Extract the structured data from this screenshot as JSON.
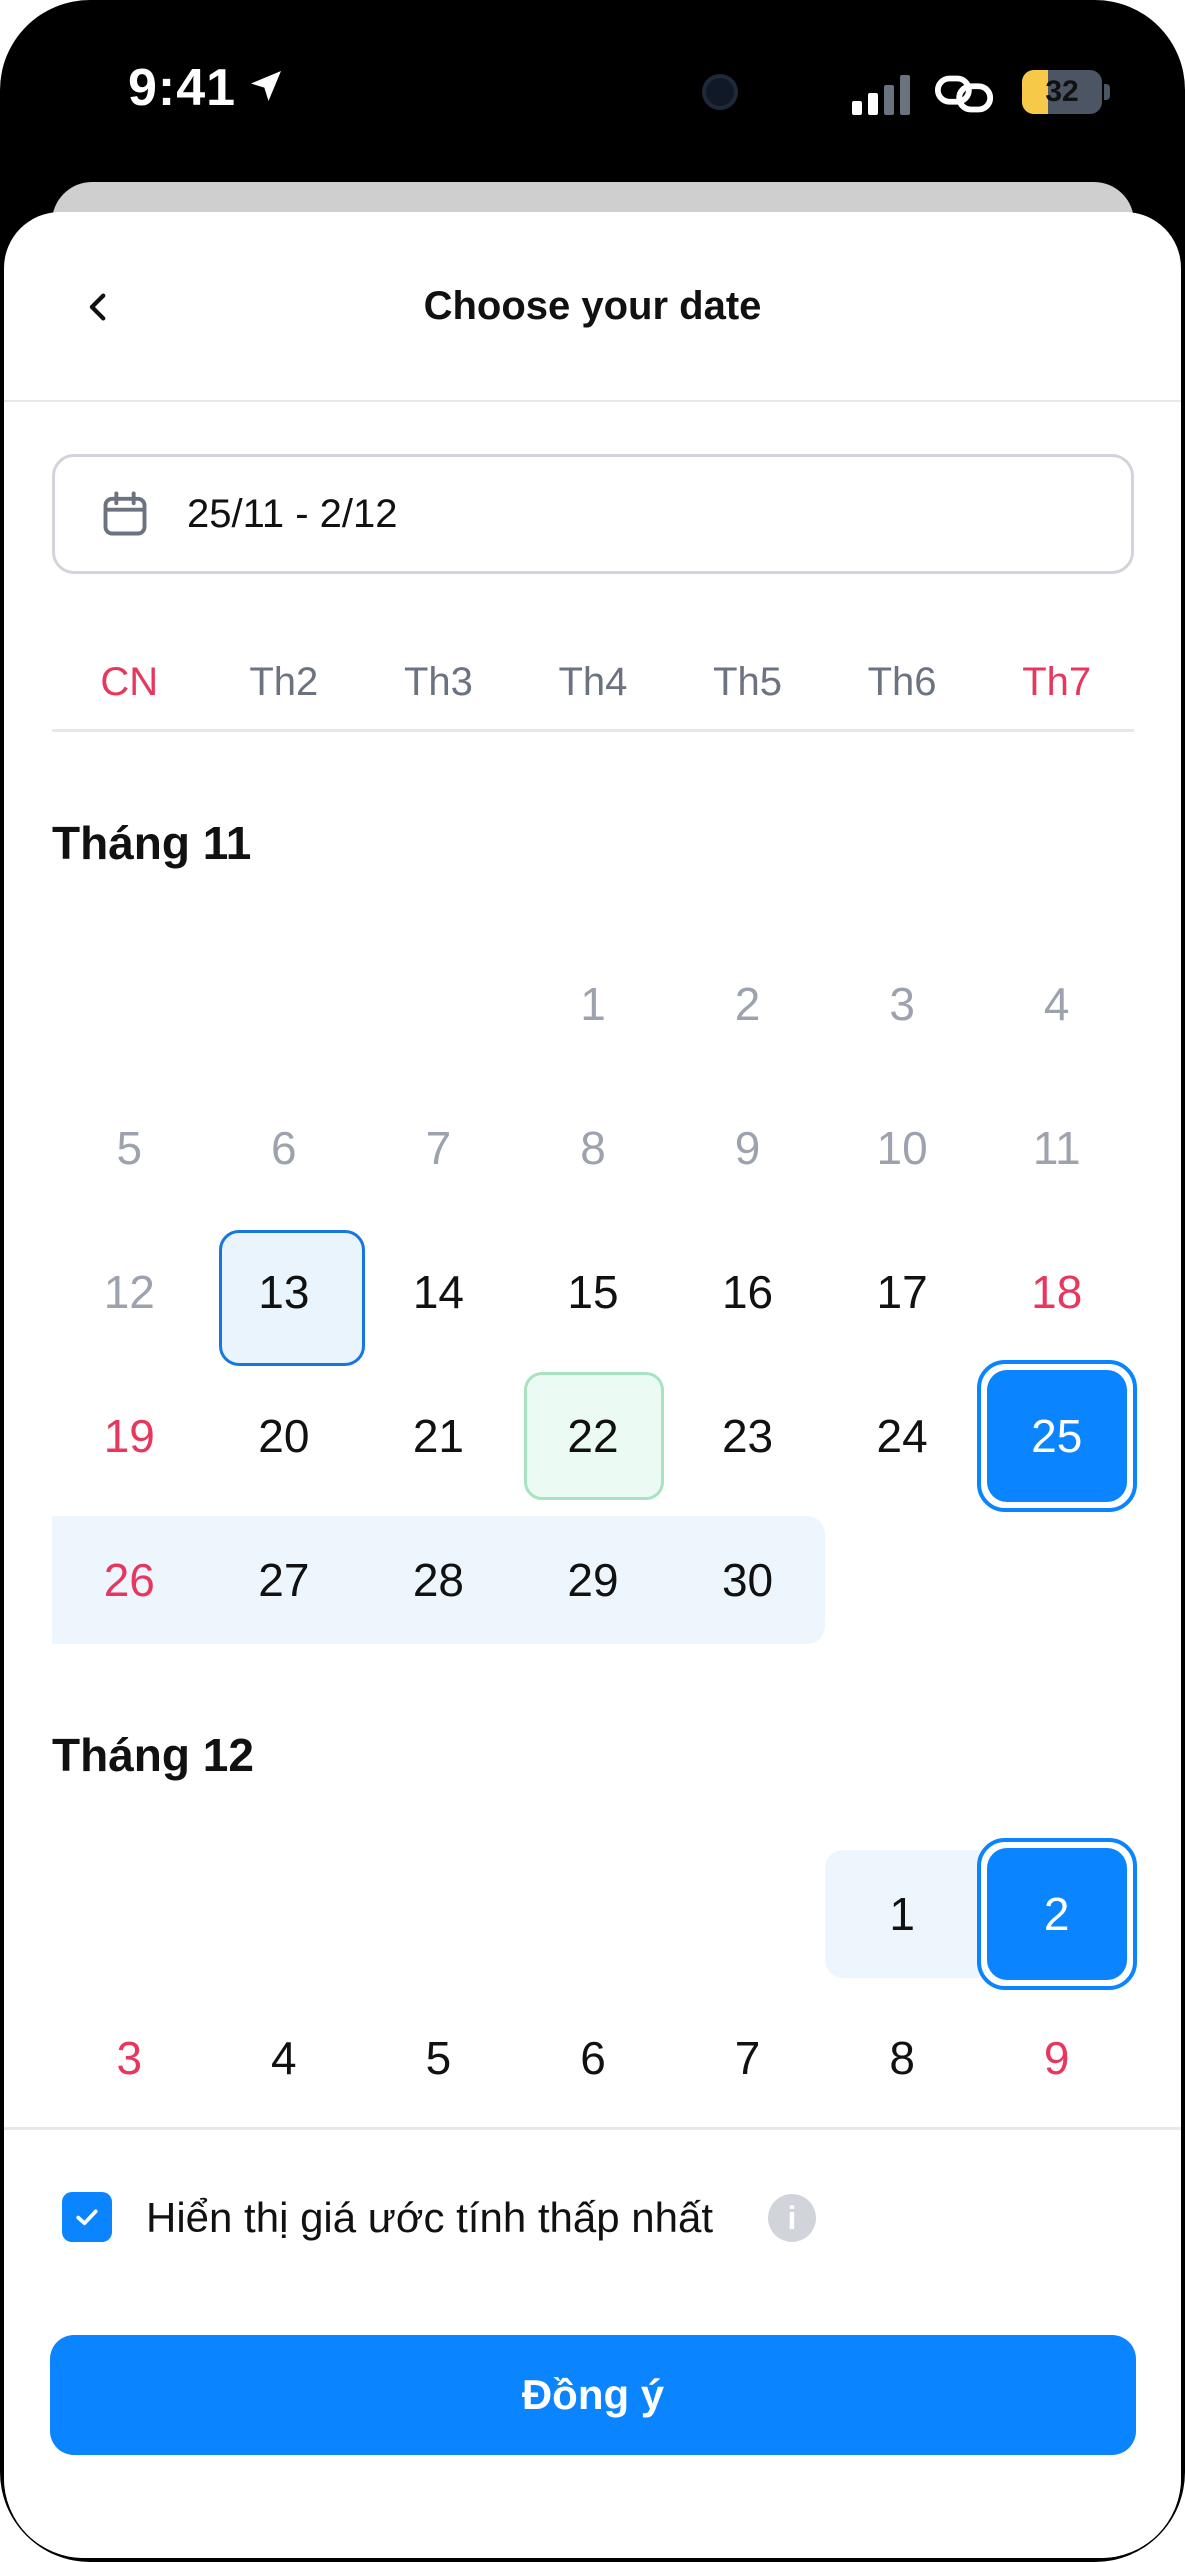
{
  "status_bar": {
    "time": "9:41",
    "battery": "32",
    "battery_level": 0.32,
    "icons": [
      "location-arrow-icon",
      "camera-icon",
      "signal-icon",
      "link-icon",
      "battery-icon"
    ]
  },
  "header": {
    "title": "Choose your date",
    "back_icon": "chevron-left-icon"
  },
  "date_input": {
    "value": "25/11 - 2/12",
    "icon": "calendar-icon"
  },
  "weekdays": [
    {
      "label": "CN",
      "weekend": true
    },
    {
      "label": "Th2",
      "weekend": false
    },
    {
      "label": "Th3",
      "weekend": false
    },
    {
      "label": "Th4",
      "weekend": false
    },
    {
      "label": "Th5",
      "weekend": false
    },
    {
      "label": "Th6",
      "weekend": false
    },
    {
      "label": "Th7",
      "weekend": true
    }
  ],
  "months": [
    {
      "title": "Tháng 11",
      "rows": [
        [
          null,
          null,
          null,
          "1",
          "2",
          "3",
          "4"
        ],
        [
          "5",
          "6",
          "7",
          "8",
          "9",
          "10",
          "11"
        ],
        [
          "12",
          "13",
          "14",
          "15",
          "16",
          "17",
          "18"
        ],
        [
          "19",
          "20",
          "21",
          "22",
          "23",
          "24",
          "25"
        ],
        [
          "26",
          "27",
          "28",
          "29",
          "30",
          null,
          null
        ]
      ]
    },
    {
      "title": "Tháng 12",
      "rows": [
        [
          null,
          null,
          null,
          null,
          null,
          "1",
          "2"
        ],
        [
          "3",
          "4",
          "5",
          "6",
          "7",
          "8",
          "9"
        ]
      ]
    }
  ],
  "selection": {
    "today": "13/11",
    "highlighted": "22/11",
    "range_start": "25/11",
    "range_end": "2/12"
  },
  "colors": {
    "primary": "#0a84ff",
    "weekend": "#e8375f",
    "muted": "#9ca3af",
    "range": "#eef6fd",
    "highlight_green": "#ebfaf2"
  },
  "footer": {
    "checkbox_label": "Hiển thị giá ước tính thấp nhất",
    "checkbox_checked": true,
    "info_icon": "info-icon",
    "button_label": "Đồng ý"
  }
}
